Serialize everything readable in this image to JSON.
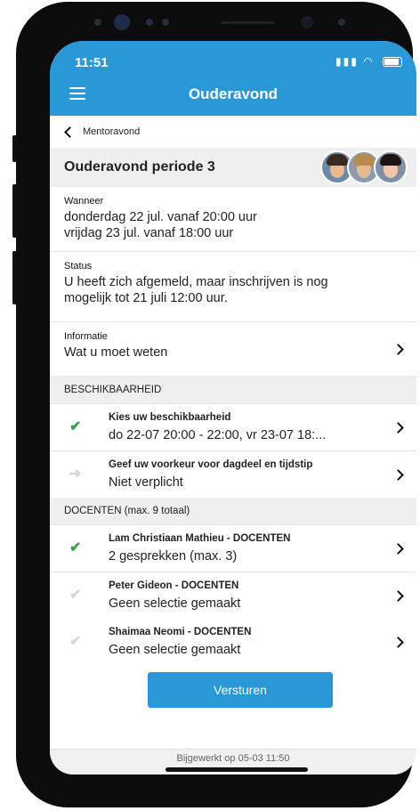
{
  "status_bar": {
    "time": "11:51",
    "icons": [
      "signal-icon",
      "wifi-icon",
      "battery-icon"
    ]
  },
  "app_bar": {
    "title": "Ouderavond",
    "menu_icon": "hamburger-menu-icon"
  },
  "breadcrumb": {
    "label": "Mentoravond"
  },
  "header": {
    "title": "Ouderavond periode 3"
  },
  "when": {
    "label": "Wanneer",
    "line1": "donderdag 22 jul. vanaf 20:00 uur",
    "line2": "vrijdag 23 jul. vanaf 18:00 uur"
  },
  "status": {
    "label": "Status",
    "line1": "U heeft zich afgemeld, maar inschrijven is nog",
    "line2": "mogelijk tot 21 juli 12:00 uur."
  },
  "info": {
    "label": "Informatie",
    "value": "Wat u moet weten"
  },
  "availability": {
    "heading": "BESCHIKBAARHEID",
    "items": [
      {
        "title": "Kies uw beschikbaarheid",
        "subtitle": "do 22-07 20:00 - 22:00, vr 23-07 18:...",
        "icon": "check-icon"
      },
      {
        "title": "Geef uw voorkeur voor dagdeel en tijdstip",
        "subtitle": "Niet verplicht",
        "icon": "arrow-right-icon"
      }
    ]
  },
  "teachers": {
    "heading": "DOCENTEN (max. 9 totaal)",
    "items": [
      {
        "title": "Lam Christiaan Mathieu - DOCENTEN",
        "subtitle": "2 gesprekken (max. 3)",
        "icon": "check-icon",
        "done": true
      },
      {
        "title": "Peter Gideon  - DOCENTEN",
        "subtitle": "Geen selectie gemaakt",
        "icon": "check-icon",
        "done": false
      },
      {
        "title": "Shaimaa Neomi  - DOCENTEN",
        "subtitle": "Geen selectie gemaakt",
        "icon": "check-icon",
        "done": false
      }
    ]
  },
  "submit": {
    "label": "Versturen"
  },
  "footer": {
    "text": "Bijgewerkt op 05-03 11:50"
  },
  "colors": {
    "primary": "#2a97d6",
    "check": "#3aa34a",
    "section_bg": "#efefef"
  }
}
